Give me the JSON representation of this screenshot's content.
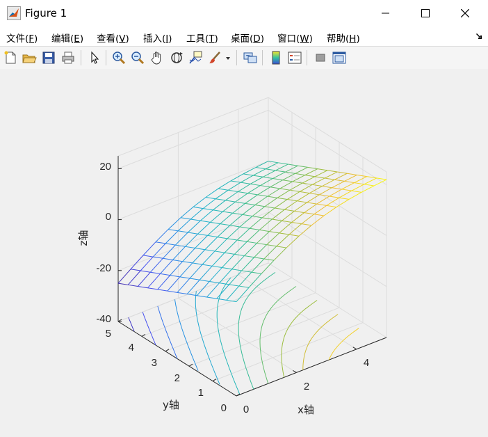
{
  "window": {
    "title": "Figure 1",
    "minimize_label": "—",
    "maximize_label": "☐",
    "close_label": "✕"
  },
  "menu": {
    "items": [
      {
        "label": "文件(",
        "key": "F",
        "suffix": ")"
      },
      {
        "label": "编辑(",
        "key": "E",
        "suffix": ")"
      },
      {
        "label": "查看(",
        "key": "V",
        "suffix": ")"
      },
      {
        "label": "插入(",
        "key": "I",
        "suffix": ")"
      },
      {
        "label": "工具(",
        "key": "T",
        "suffix": ")"
      },
      {
        "label": "桌面(",
        "key": "D",
        "suffix": ")"
      },
      {
        "label": "窗口(",
        "key": "W",
        "suffix": ")"
      },
      {
        "label": "帮助(",
        "key": "H",
        "suffix": ")"
      }
    ],
    "overflow_icon": "arrow-down-right-icon"
  },
  "toolbar": {
    "icons": [
      "new-figure-icon",
      "open-file-icon",
      "save-icon",
      "print-icon",
      "edit-plot-icon",
      "zoom-in-icon",
      "zoom-out-icon",
      "pan-icon",
      "rotate-3d-icon",
      "data-cursor-icon",
      "brush-icon",
      "link-plot-icon",
      "colorbar-icon",
      "legend-icon",
      "hide-plot-tools-icon",
      "show-plot-tools-icon"
    ]
  },
  "axes": {
    "x_label": "x轴",
    "y_label": "y轴",
    "z_label": "z轴",
    "x_ticks": [
      "0",
      "2",
      "4"
    ],
    "y_ticks": [
      "0",
      "1",
      "2",
      "3",
      "4",
      "5"
    ],
    "z_ticks": [
      "-40",
      "-20",
      "0",
      "20"
    ]
  },
  "chart_data": {
    "type": "surface-mesh with contour projection",
    "x_range": [
      0,
      5
    ],
    "y_range": [
      0,
      5
    ],
    "z_range": [
      -40,
      25
    ],
    "x_ticks": [
      0,
      2,
      4
    ],
    "y_ticks": [
      0,
      1,
      2,
      3,
      4,
      5
    ],
    "z_ticks": [
      -40,
      -20,
      0,
      20
    ],
    "grid": true,
    "colormap": "parula",
    "surface_corners": [
      {
        "x": 0,
        "y": 0,
        "z": -3
      },
      {
        "x": 5,
        "y": 0,
        "z": 22
      },
      {
        "x": 0,
        "y": 5,
        "z": -25
      },
      {
        "x": 5,
        "y": 5,
        "z": 0
      }
    ]
  }
}
